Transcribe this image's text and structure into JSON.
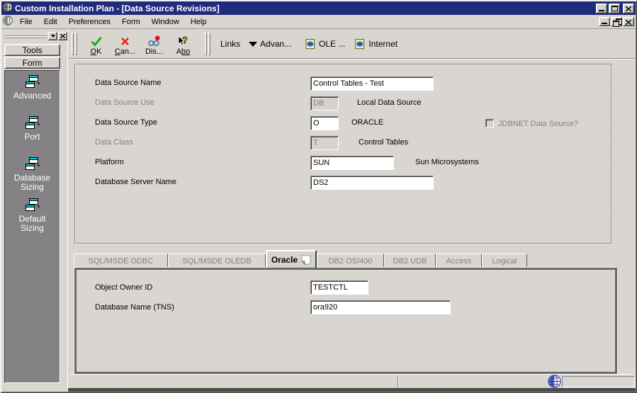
{
  "titlebar": {
    "title": "Custom Installation Plan - [Data Source Revisions]"
  },
  "menubar": {
    "items": [
      "File",
      "Edit",
      "Preferences",
      "Form",
      "Window",
      "Help"
    ]
  },
  "toolbar": {
    "buttons": [
      {
        "pre": "",
        "u": "O",
        "post": "K"
      },
      {
        "pre": "",
        "u": "C",
        "post": "an..."
      },
      {
        "pre": "Dis...",
        "u": "",
        "post": ""
      },
      {
        "pre": "A",
        "u": "bo",
        "post": ""
      }
    ],
    "links_label": "Links",
    "advanced_label": "Advan...",
    "ole_label": "OLE ...",
    "internet_label": "Internet"
  },
  "sidebar": {
    "tools_tab": "Tools",
    "form_tab": "Form",
    "items": [
      {
        "lines": [
          "Advanced"
        ]
      },
      {
        "lines": [
          "Port"
        ]
      },
      {
        "lines": [
          "Database",
          "Sizing"
        ]
      },
      {
        "lines": [
          "Default",
          "Sizing"
        ]
      }
    ]
  },
  "form": {
    "fields": [
      {
        "label": "Data Source Name",
        "value": "Control Tables - Test",
        "suffix": ""
      },
      {
        "label": "Data Source Use",
        "value": "DB",
        "suffix": "Local Data Source"
      },
      {
        "label": "Data Source Type",
        "value": "O",
        "suffix": "ORACLE"
      },
      {
        "label": "Data Class",
        "value": "T",
        "suffix": "Control Tables"
      },
      {
        "label": "Platform",
        "value": "SUN",
        "suffix": "Sun Microsystems"
      },
      {
        "label": "Database Server Name",
        "value": "DS2",
        "suffix": ""
      }
    ],
    "jdbnet_label": "JDBNET Data Source?"
  },
  "tabs": {
    "items": [
      {
        "label": "SQL/MSDE ODBC"
      },
      {
        "label": "SQL/MSDE OLEDB"
      },
      {
        "label": "Oracle"
      },
      {
        "label": "DB2 OS/400"
      },
      {
        "label": "DB2 UDB"
      },
      {
        "label": "Access"
      },
      {
        "label": "Logical"
      }
    ]
  },
  "oracle_tab": {
    "fields": [
      {
        "label": "Object Owner ID",
        "value": "TESTCTL"
      },
      {
        "label": "Database Name (TNS)",
        "value": "ora920"
      }
    ]
  }
}
